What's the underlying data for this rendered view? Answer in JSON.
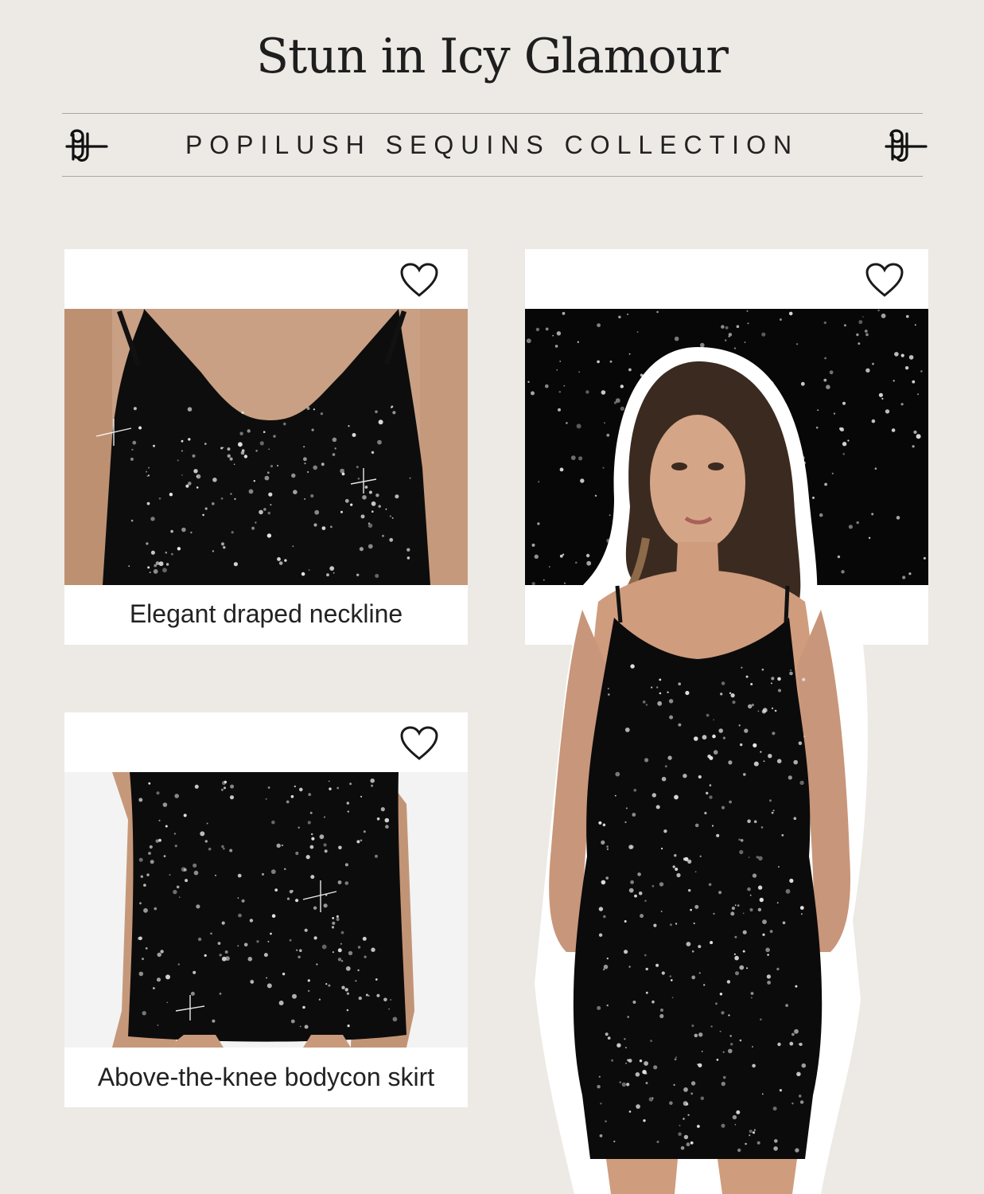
{
  "header": {
    "title": "Stun in Icy Glamour",
    "subtitle": "POPILUSH SEQUINS COLLECTION",
    "logo": "pj-monogram-logo"
  },
  "cards": [
    {
      "caption": "Elegant draped neckline",
      "icon": "heart-icon",
      "photo": "neckline-closeup"
    },
    {
      "caption": "",
      "icon": "heart-icon",
      "photo": "sequin-fabric-closeup"
    },
    {
      "caption": "Above-the-knee bodycon skirt",
      "icon": "heart-icon",
      "photo": "skirt-closeup"
    }
  ],
  "model_photo": "model-in-black-sequin-dress",
  "colors": {
    "background": "#edeae5",
    "card": "#ffffff",
    "dress": "#0b0b0b",
    "text": "#1e1e1e"
  }
}
